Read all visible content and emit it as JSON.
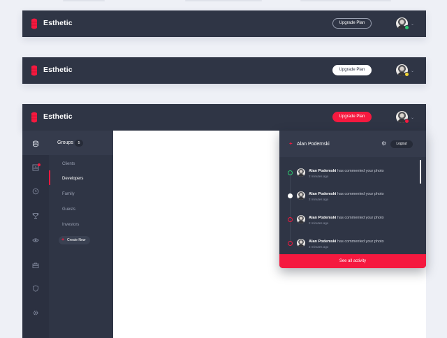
{
  "colors": {
    "bar_bg": "#2f3545",
    "accent_red": "#f5193f",
    "status_green": "#2ecc71",
    "status_yellow": "#f3d433",
    "status_red": "#f5193f"
  },
  "variants": [
    {
      "brand": "Esthetic",
      "upgrade_label": "Upgrade Plan",
      "upgrade_style": "outline",
      "status": "green"
    },
    {
      "brand": "Esthetic",
      "upgrade_label": "Upgrade Plan",
      "upgrade_style": "white",
      "status": "yellow"
    },
    {
      "brand": "Esthetic",
      "upgrade_label": "Upgrade Plan",
      "upgrade_style": "red",
      "status": "red"
    }
  ],
  "rail": {
    "icons": [
      "database-icon",
      "chart-icon",
      "clock-icon",
      "trophy-icon",
      "eye-icon",
      "briefcase-icon",
      "shield-icon",
      "settings-icon"
    ]
  },
  "groups": {
    "title": "Groups",
    "count": "5",
    "items": [
      "Clients",
      "Developers",
      "Family",
      "Guests",
      "Investors"
    ],
    "active_index": 1,
    "create_label": "Create New"
  },
  "activity": {
    "user_name": "Alan Podemski",
    "logout_label": "Logout",
    "items": [
      {
        "name": "Alan Podemski",
        "text": "has commented your photo",
        "time": "2 minutes ago",
        "marker": "green"
      },
      {
        "name": "Alan Podemski",
        "text": "has commented your photo",
        "time": "2 minutes ago",
        "marker": "white"
      },
      {
        "name": "Alan Podemski",
        "text": "has commented your photo",
        "time": "2 minutes ago",
        "marker": "red"
      },
      {
        "name": "Alan Podemski",
        "text": "has commented your photo",
        "time": "2 minutes ago",
        "marker": "red"
      }
    ],
    "see_all_label": "See all activity"
  }
}
